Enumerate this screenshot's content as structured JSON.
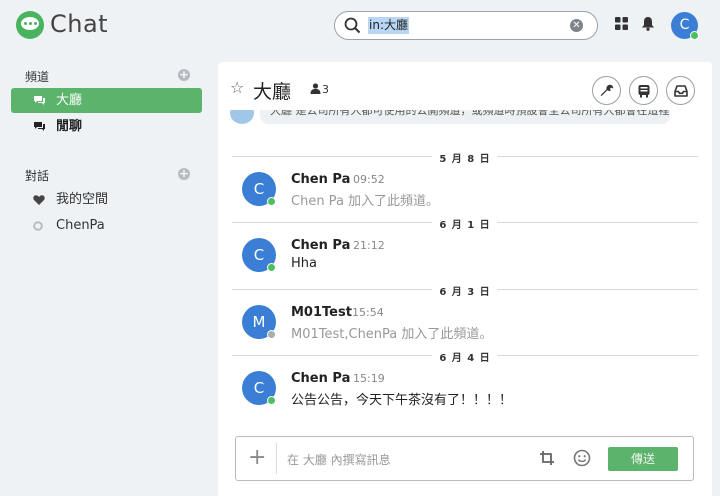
{
  "app": {
    "title": "Chat"
  },
  "search": {
    "query": "in:大廳"
  },
  "user": {
    "avatar_initial": "C"
  },
  "sidebar": {
    "channels_header": "頻道",
    "channels": [
      {
        "label": "大廳",
        "active": true
      },
      {
        "label": "閒聊",
        "active": false
      }
    ],
    "dm_header": "對話",
    "dms": [
      {
        "label": "我的空間",
        "icon": "heart-icon"
      },
      {
        "label": "ChenPa",
        "icon": "status-offline-icon"
      }
    ]
  },
  "channel": {
    "title": "大廳",
    "member_count": "3"
  },
  "clipped_message": "大廳 是公司所有人都可使用的公開頻道，或頻道時預設會全公司所有人都會在這裡",
  "messages": [
    {
      "date": "5 月 8 日",
      "author": "Chen Pa",
      "time": "09:52",
      "avatar": "C",
      "status": "online",
      "text": "Chen Pa 加入了此頻道。",
      "system": true
    },
    {
      "date": "6 月 1 日",
      "author": "Chen Pa",
      "time": "21:12",
      "avatar": "C",
      "status": "online",
      "text": "Hha",
      "system": false
    },
    {
      "date": "6 月 3 日",
      "author": "M01Test",
      "time": "15:54",
      "avatar": "M",
      "status": "offline",
      "text": "M01Test,ChenPa 加入了此頻道。",
      "system": true
    },
    {
      "date": "6 月 4 日",
      "author": "Chen Pa",
      "time": "15:19",
      "avatar": "C",
      "status": "online",
      "text": "公告公告，今天下午茶沒有了！！！！",
      "system": false
    }
  ],
  "composer": {
    "placeholder": "在 大廳 內撰寫訊息",
    "send_label": "傳送"
  },
  "colors": {
    "accent": "#5cb36b",
    "avatar": "#3a7fd5",
    "online": "#4cbf5e"
  }
}
